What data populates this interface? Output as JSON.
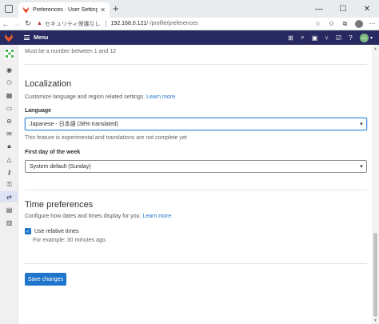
{
  "browser": {
    "tab_title": "Preferences · User Settings · Git",
    "tab_close": "✕",
    "new_tab": "+",
    "security_label": "セキュリティ保護なし",
    "url_host": "192.168.0.121",
    "url_path": "/-/profile/preferences",
    "icons": [
      "back-icon",
      "forward-icon",
      "refresh-icon",
      "favorites-icon",
      "collections-icon",
      "extensions-icon",
      "profile-icon",
      "more-icon"
    ]
  },
  "navbar": {
    "menu_label": "Menu",
    "avatar_text": "2.5",
    "icons": [
      "plus-icon",
      "search-icon",
      "issues-icon",
      "merge-requests-icon",
      "todos-icon",
      "help-icon",
      "avatar"
    ]
  },
  "sidebar": {
    "items": [
      "user-avatar",
      "profile",
      "account",
      "applications",
      "chat",
      "access-tokens",
      "emails",
      "password",
      "notifications",
      "ssh-keys",
      "gpg-keys",
      "preferences",
      "active-sessions",
      "auth-log"
    ]
  },
  "main": {
    "prev_help": "Must be a number between 1 and 12",
    "localization": {
      "title": "Localization",
      "description": "Customize language and region related settings.",
      "learn_more": "Learn more.",
      "language_label": "Language",
      "language_value": "Japanese - 日本語 (38% translated)",
      "language_help": "This feature is experimental and translations are not complete yet",
      "first_day_label": "First day of the week",
      "first_day_value": "System default (Sunday)"
    },
    "time": {
      "title": "Time preferences",
      "description": "Configure how dates and times display for you.",
      "learn_more": "Learn more.",
      "relative_label": "Use relative times",
      "relative_checked": true,
      "relative_help": "For example: 30 minutes ago."
    },
    "save_label": "Save changes"
  },
  "colors": {
    "navbar": "#292961",
    "accent": "#1f75cb"
  }
}
